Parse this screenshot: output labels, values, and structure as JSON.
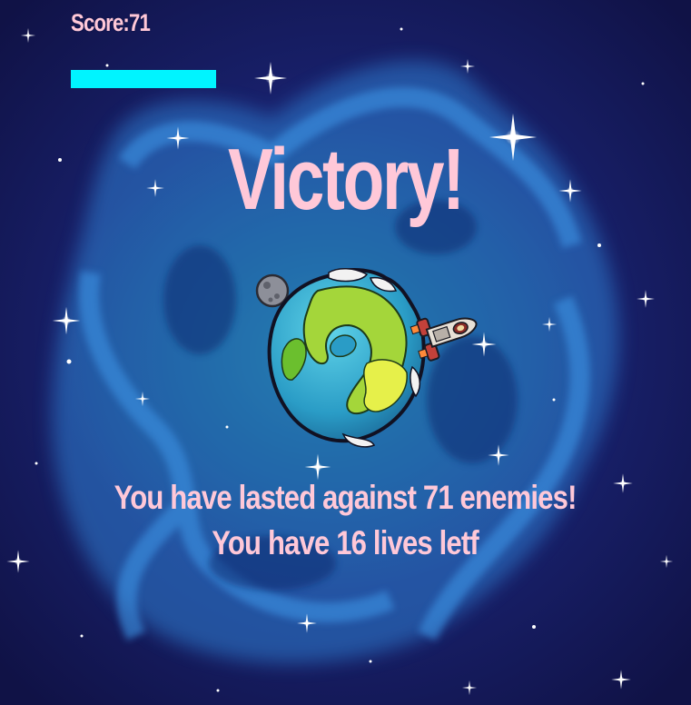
{
  "hud": {
    "score_text": "Score:71",
    "health_level": 1.0,
    "health_color": "#00f4ff"
  },
  "result": {
    "title": "Victory!",
    "line_1": "You have lasted against 71 enemies!",
    "line_2": "You have 16 lives letf"
  },
  "colors": {
    "text": "#ffc8d8",
    "space": "#18206a",
    "nebula": "#2a6fbf"
  },
  "sprites": {
    "planet": "earth-planet-icon",
    "moon": "moon-icon",
    "ship": "spaceship-icon",
    "stars": "star-icon"
  }
}
